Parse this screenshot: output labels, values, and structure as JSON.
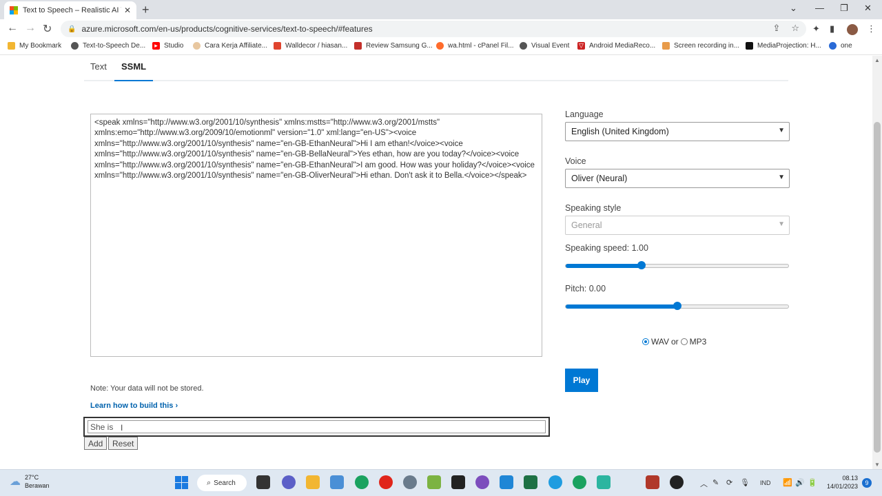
{
  "browser": {
    "tab_title": "Text to Speech – Realistic AI Voic",
    "tab_close": "✕",
    "new_tab": "+",
    "url": "azure.microsoft.com/en-us/products/cognitive-services/text-to-speech/#features"
  },
  "bookmarks": [
    {
      "label": "My Bookmark",
      "color": "#f2b632"
    },
    {
      "label": "Text-to-Speech De...",
      "color": "#555555"
    },
    {
      "label": "Studio",
      "color": "#ff0000"
    },
    {
      "label": "Cara Kerja Affiliate...",
      "color": "#e8c7a0"
    },
    {
      "label": "Walldecor / hiasan...",
      "color": "#e0442e"
    },
    {
      "label": "Review Samsung G...",
      "color": "#c4302b"
    },
    {
      "label": "wa.html - cPanel Fil...",
      "color": "#ff6c2c"
    },
    {
      "label": "Visual Event",
      "color": "#555555"
    },
    {
      "label": "Android MediaReco...",
      "color": "#cc2222"
    },
    {
      "label": "Screen recording in...",
      "color": "#e89b4a"
    },
    {
      "label": "MediaProjection: H...",
      "color": "#111111"
    },
    {
      "label": "one",
      "color": "#2a6ad6"
    }
  ],
  "tabs": {
    "text": "Text",
    "ssml": "SSML"
  },
  "ssml_text": "<speak xmlns=\"http://www.w3.org/2001/10/synthesis\" xmlns:mstts=\"http://www.w3.org/2001/mstts\" xmlns:emo=\"http://www.w3.org/2009/10/emotionml\" version=\"1.0\" xml:lang=\"en-US\"><voice xmlns=\"http://www.w3.org/2001/10/synthesis\" name=\"en-GB-EthanNeural\">Hi I am ethan!</voice><voice xmlns=\"http://www.w3.org/2001/10/synthesis\" name=\"en-GB-BellaNeural\">Yes ethan, how are you today?</voice><voice xmlns=\"http://www.w3.org/2001/10/synthesis\" name=\"en-GB-EthanNeural\">I am good. How was your holiday?</voice><voice xmlns=\"http://www.w3.org/2001/10/synthesis\" name=\"en-GB-OliverNeural\">Hi ethan. Don't ask it to Bella.</voice></speak>",
  "note": "Note: Your data will not be stored.",
  "learn_link": "Learn how to build this",
  "input_value": "She is",
  "add_button": "Add",
  "reset_button": "Reset",
  "settings": {
    "language_label": "Language",
    "language_value": "English (United Kingdom)",
    "voice_label": "Voice",
    "voice_value": "Oliver (Neural)",
    "style_label": "Speaking style",
    "style_value": "General",
    "speed_label": "Speaking speed: 1.00",
    "speed_fraction": 0.34,
    "pitch_label": "Pitch: 0.00",
    "pitch_fraction": 0.5,
    "format_wav": "WAV",
    "format_or": "or",
    "format_mp3": "MP3",
    "play_button": "Play"
  },
  "taskbar": {
    "temperature": "27°C",
    "weather": "Berawan",
    "search": "Search",
    "language": "IND",
    "time": "08.13",
    "date": "14/01/2023",
    "notifications": "9"
  }
}
